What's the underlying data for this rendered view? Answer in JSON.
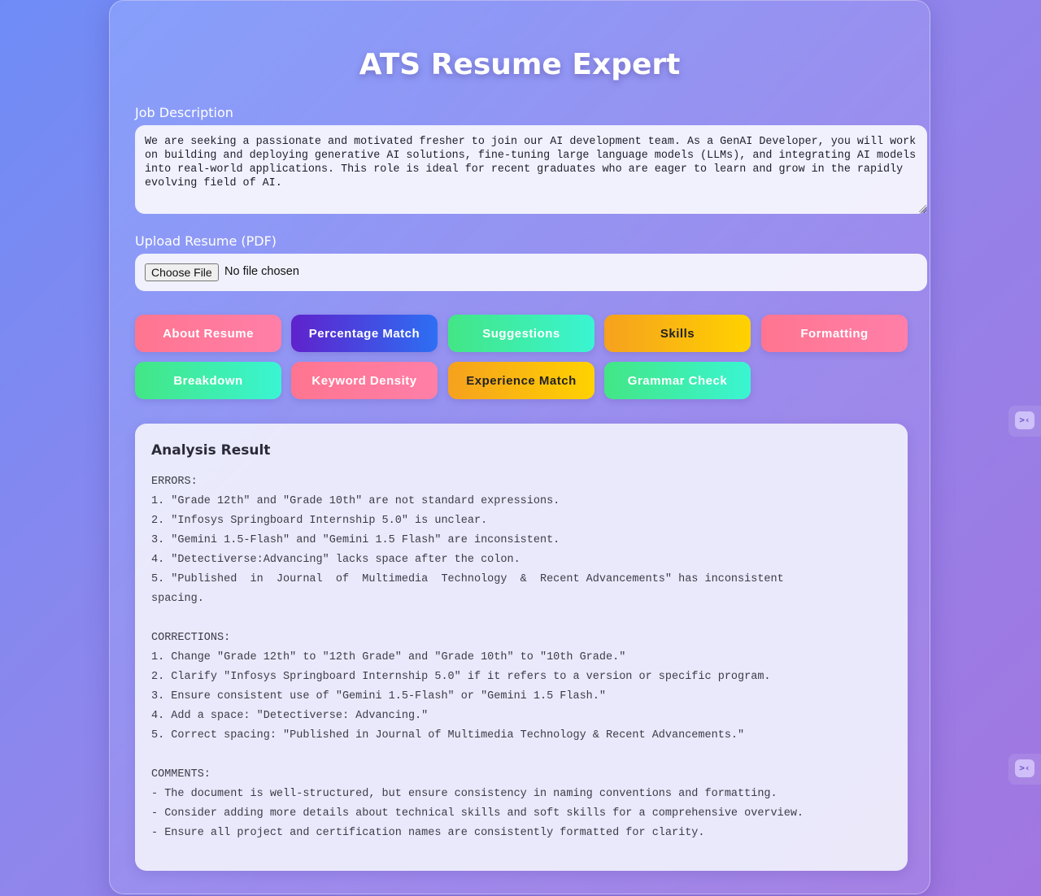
{
  "app": {
    "title": "ATS Resume Expert"
  },
  "job_description": {
    "label": "Job Description",
    "value": "We are seeking a passionate and motivated fresher to join our AI development team. As a GenAI Developer, you will work on building and deploying generative AI solutions, fine-tuning large language models (LLMs), and integrating AI models into real-world applications. This role is ideal for recent graduates who are eager to learn and grow in the rapidly evolving field of AI."
  },
  "upload": {
    "label": "Upload Resume (PDF)",
    "button_label": "Choose File",
    "status": "No file chosen"
  },
  "actions": [
    {
      "label": "About Resume",
      "style": "pink"
    },
    {
      "label": "Percentage Match",
      "style": "purple"
    },
    {
      "label": "Suggestions",
      "style": "green"
    },
    {
      "label": "Skills",
      "style": "orange"
    },
    {
      "label": "Formatting",
      "style": "pink"
    },
    {
      "label": "Breakdown",
      "style": "green"
    },
    {
      "label": "Keyword Density",
      "style": "pink"
    },
    {
      "label": "Experience Match",
      "style": "orange"
    },
    {
      "label": "Grammar Check",
      "style": "green"
    }
  ],
  "result": {
    "title": "Analysis Result",
    "text": "ERRORS:\n1. \"Grade 12th\" and \"Grade 10th\" are not standard expressions.\n2. \"Infosys Springboard Internship 5.0\" is unclear.\n3. \"Gemini 1.5-Flash\" and \"Gemini 1.5 Flash\" are inconsistent.\n4. \"Detectiverse:Advancing\" lacks space after the colon.\n5. \"Published  in  Journal  of  Multimedia  Technology  &  Recent Advancements\" has inconsistent\nspacing.\n\nCORRECTIONS:\n1. Change \"Grade 12th\" to \"12th Grade\" and \"Grade 10th\" to \"10th Grade.\"\n2. Clarify \"Infosys Springboard Internship 5.0\" if it refers to a version or specific program.\n3. Ensure consistent use of \"Gemini 1.5-Flash\" or \"Gemini 1.5 Flash.\"\n4. Add a space: \"Detectiverse: Advancing.\"\n5. Correct spacing: \"Published in Journal of Multimedia Technology & Recent Advancements.\"\n\nCOMMENTS:\n- The document is well-structured, but ensure consistency in naming conventions and formatting.\n- Consider adding more details about technical skills and soft skills for a comprehensive overview.\n- Ensure all project and certification names are consistently formatted for clarity."
  },
  "side_widgets": [
    {
      "icon": "extension-icon"
    },
    {
      "icon": "extension-icon"
    }
  ],
  "colors": {
    "pink": "#ff7590",
    "purple": "#5f22cc",
    "green": "#43e685",
    "orange": "#f6a11e",
    "background": "#8f86ec"
  }
}
